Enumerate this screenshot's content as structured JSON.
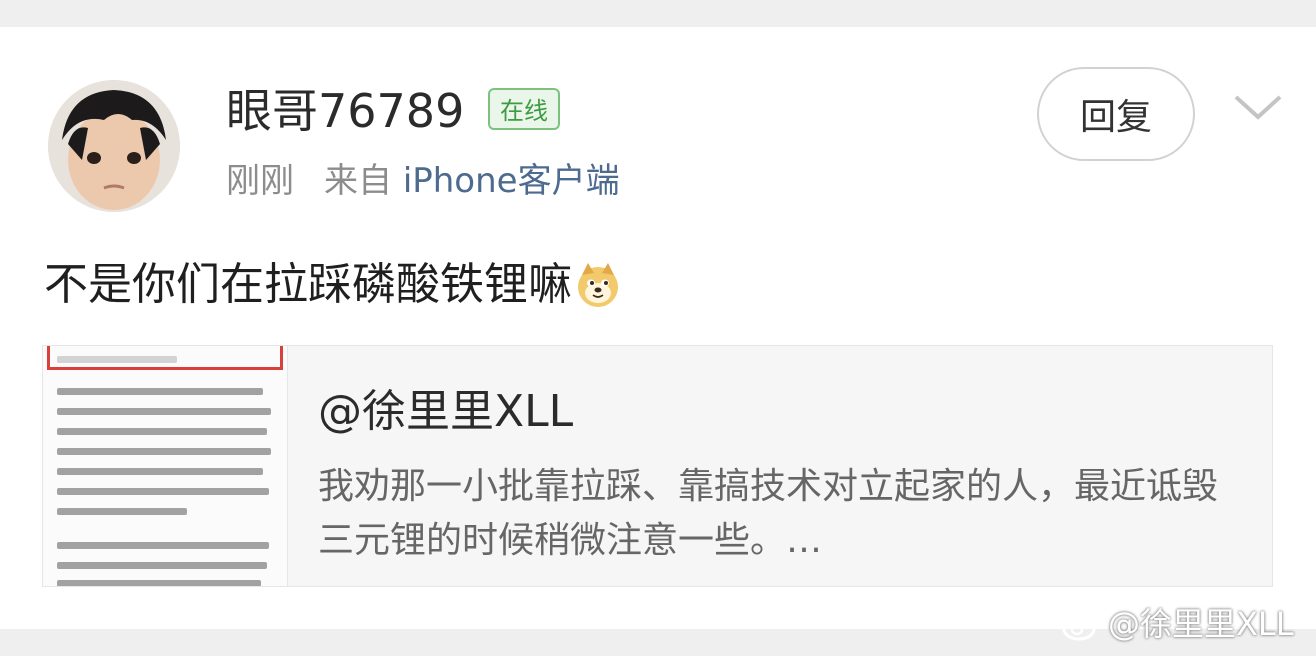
{
  "post": {
    "username": "眼哥76789",
    "online_badge": "在线",
    "time": "刚刚",
    "source_prefix": "来自",
    "source_client": "iPhone客户端",
    "reply_label": "回复",
    "text": "不是你们在拉踩磷酸铁锂嘛"
  },
  "quote": {
    "author": "@徐里里XLL",
    "text": "我劝那一小批靠拉踩、靠搞技术对立起家的人，最近诋毁三元锂的时候稍微注意一些。…"
  },
  "watermark": {
    "text": "@徐里里XLL"
  },
  "colors": {
    "online_green": "#3d9b42",
    "link_blue": "#4d6a8f",
    "thumb_red_frame": "#d8403a"
  },
  "icons": {
    "expand": "chevron-down-icon",
    "emoji": "doge-emoji-icon",
    "watermark_logo": "weibo-logo-icon"
  }
}
